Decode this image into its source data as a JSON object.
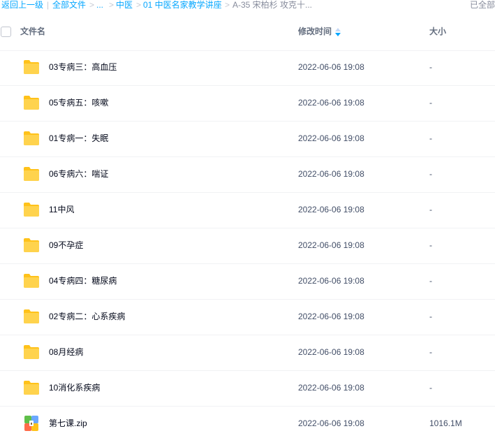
{
  "breadcrumb": {
    "back": "返回上一级",
    "sep1": "|",
    "all_files": "全部文件",
    "gt1": ">",
    "ellipsis": "...",
    "gt2": ">",
    "folder1": "中医",
    "gt3": ">",
    "folder2": "01 中医名家教学讲座",
    "gt4": ">",
    "current": "A-35 宋柏杉 攻克十..."
  },
  "loaded_all": "已全部",
  "header": {
    "name": "文件名",
    "modified": "修改时间",
    "size": "大小"
  },
  "colors": {
    "link": "#06a7ff",
    "folder": "#ffd34d",
    "sort": "#06a7ff"
  },
  "files": [
    {
      "name": "03专病三：高血压",
      "time": "2022-06-06 19:08",
      "size": "-",
      "icon": "folder-icon"
    },
    {
      "name": "05专病五：咳嗽",
      "time": "2022-06-06 19:08",
      "size": "-",
      "icon": "folder-icon"
    },
    {
      "name": "01专病一：失眠",
      "time": "2022-06-06 19:08",
      "size": "-",
      "icon": "folder-icon"
    },
    {
      "name": "06专病六：喘证",
      "time": "2022-06-06 19:08",
      "size": "-",
      "icon": "folder-icon"
    },
    {
      "name": "11中风",
      "time": "2022-06-06 19:08",
      "size": "-",
      "icon": "folder-icon"
    },
    {
      "name": "09不孕症",
      "time": "2022-06-06 19:08",
      "size": "-",
      "icon": "folder-icon"
    },
    {
      "name": "04专病四：糖尿病",
      "time": "2022-06-06 19:08",
      "size": "-",
      "icon": "folder-icon"
    },
    {
      "name": "02专病二：心系疾病",
      "time": "2022-06-06 19:08",
      "size": "-",
      "icon": "folder-icon"
    },
    {
      "name": "08月经病",
      "time": "2022-06-06 19:08",
      "size": "-",
      "icon": "folder-icon"
    },
    {
      "name": "10消化系疾病",
      "time": "2022-06-06 19:08",
      "size": "-",
      "icon": "folder-icon"
    },
    {
      "name": "第七课.zip",
      "time": "2022-06-06 19:08",
      "size": "1016.1M",
      "icon": "zip-archive-icon"
    }
  ]
}
